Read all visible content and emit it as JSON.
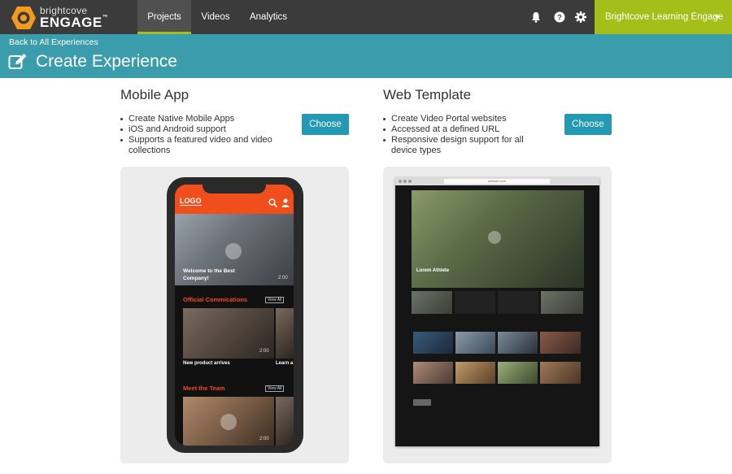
{
  "brand": {
    "small": "brightcove",
    "main": "ENGAGE",
    "trademark": "™",
    "orange": "#f39a1f",
    "nav_bg": "#3b3b3b",
    "accent_green": "#a5bf1a",
    "header_teal": "#3b9dab",
    "button_teal": "#2399b4"
  },
  "nav": {
    "tabs": [
      {
        "label": "Projects",
        "active": true
      },
      {
        "label": "Videos",
        "active": false
      },
      {
        "label": "Analytics",
        "active": false
      }
    ],
    "icons": [
      "bell-icon",
      "help-icon",
      "gear-icon"
    ],
    "account": {
      "label": "Brightcove Learning Engage",
      "caret": "▼"
    }
  },
  "header": {
    "back_link": "Back to All Experiences",
    "title": "Create Experience",
    "title_icon": "edit-icon"
  },
  "options": [
    {
      "title": "Mobile App",
      "bullets": [
        "Create Native Mobile Apps",
        "iOS and Android support",
        "Supports a featured video and video collections"
      ],
      "button": "Choose"
    },
    {
      "title": "Web Template",
      "bullets": [
        "Create Video Portal websites",
        "Accessed at a defined URL",
        "Responsive design support for all device types"
      ],
      "button": "Choose"
    }
  ],
  "mobile_preview": {
    "logo": "LOGO",
    "hero_caption": "Welcome to the Best Company!",
    "hero_duration": "2:00",
    "section1": "Official Commications",
    "view_all_1": "View All",
    "thumb1_caption": "New product arrives",
    "thumb1_duration": "2:00",
    "thumb2_caption": "Learn a",
    "section2": "Meet the Team",
    "view_all_2": "View All",
    "thumb3_duration": "2:00"
  },
  "web_preview": {
    "url": "website.com",
    "hero_title": "Lorem Athlete"
  }
}
